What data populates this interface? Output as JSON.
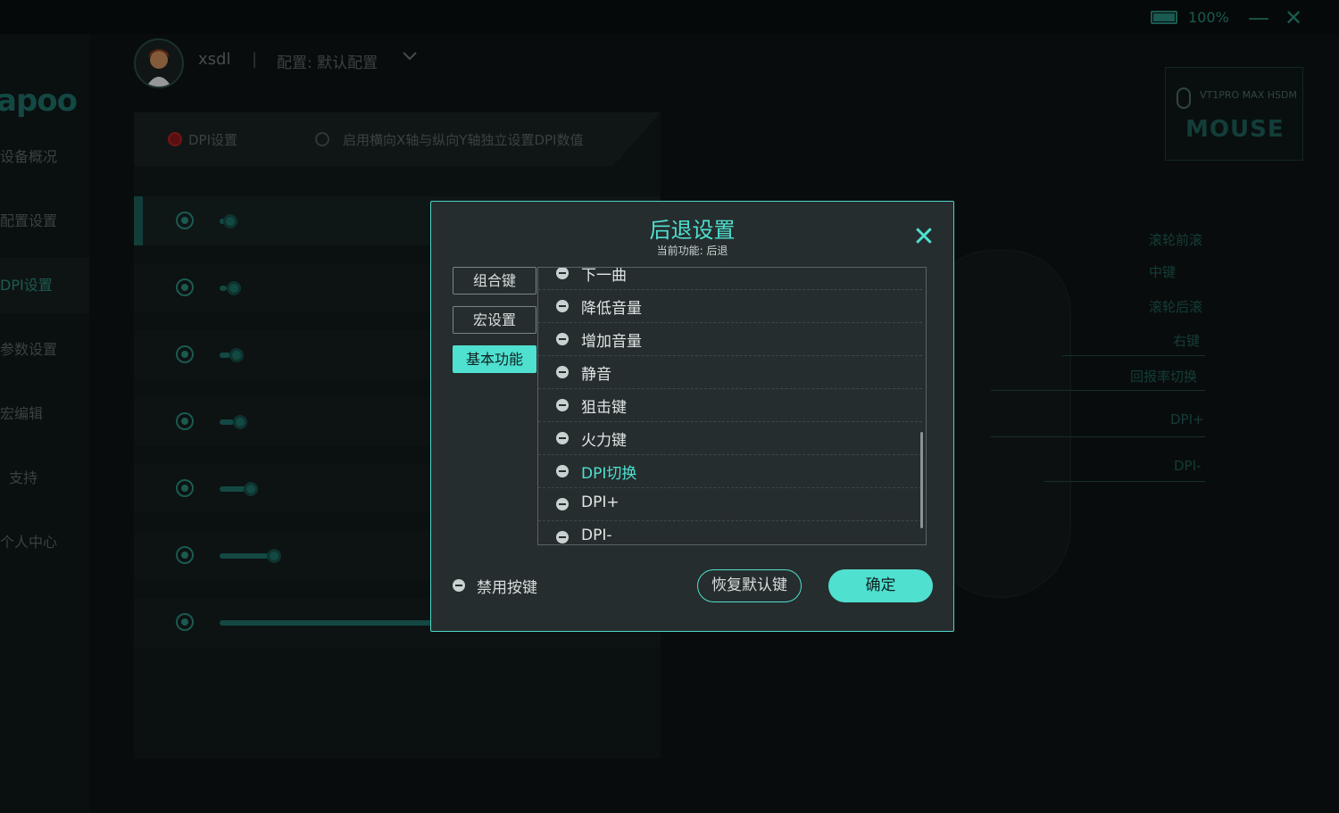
{
  "window": {
    "battery_text": "100%",
    "minimize_icon": "minimize-icon",
    "close_icon": "close-icon"
  },
  "sidebar": {
    "logo": "apoo",
    "items": [
      {
        "label": "设备概况"
      },
      {
        "label": "配置设置"
      },
      {
        "label": "DPI设置",
        "active": true
      },
      {
        "label": "参数设置"
      },
      {
        "label": "宏编辑"
      },
      {
        "label": "支持"
      },
      {
        "label": "个人中心"
      }
    ]
  },
  "header": {
    "username": "xsdl",
    "separator": "|",
    "config_label": "配置: 默认配置"
  },
  "dpi_panel": {
    "tab_dpi": "DPI设置",
    "tab_xy": "启用横向X轴与纵向Y轴独立设置DPI数值",
    "rows": [
      {
        "value": "400"
      },
      {
        "value": "800"
      },
      {
        "value": "1200"
      },
      {
        "value": "1600"
      },
      {
        "value": "3200"
      },
      {
        "value": "6400"
      },
      {
        "value": "30000"
      }
    ]
  },
  "device": {
    "name": "VT1PRO MAX HSDM",
    "type": "MOUSE"
  },
  "mouse_buttons": {
    "labels": [
      "滚轮前滚",
      "中键",
      "滚轮后滚",
      "右键",
      "回报率切换",
      "DPI+",
      "DPI-"
    ]
  },
  "modal": {
    "title": "后退设置",
    "subtitle": "当前功能: 后退",
    "side_buttons": [
      {
        "label": "组合键"
      },
      {
        "label": "宏设置"
      },
      {
        "label": "基本功能",
        "active": true
      }
    ],
    "list_items": [
      {
        "label": "下一曲"
      },
      {
        "label": "降低音量"
      },
      {
        "label": "增加音量"
      },
      {
        "label": "静音"
      },
      {
        "label": "狙击键"
      },
      {
        "label": "火力键"
      },
      {
        "label": "DPI切换",
        "selected": true
      },
      {
        "label": "DPI+"
      },
      {
        "label": "DPI-"
      }
    ],
    "disable_label": "禁用按键",
    "restore_label": "恢复默认键",
    "confirm_label": "确定"
  },
  "colors": {
    "accent": "#4fe0d0",
    "modal_bg": "#262d2e",
    "app_bg": "#0e1313"
  }
}
